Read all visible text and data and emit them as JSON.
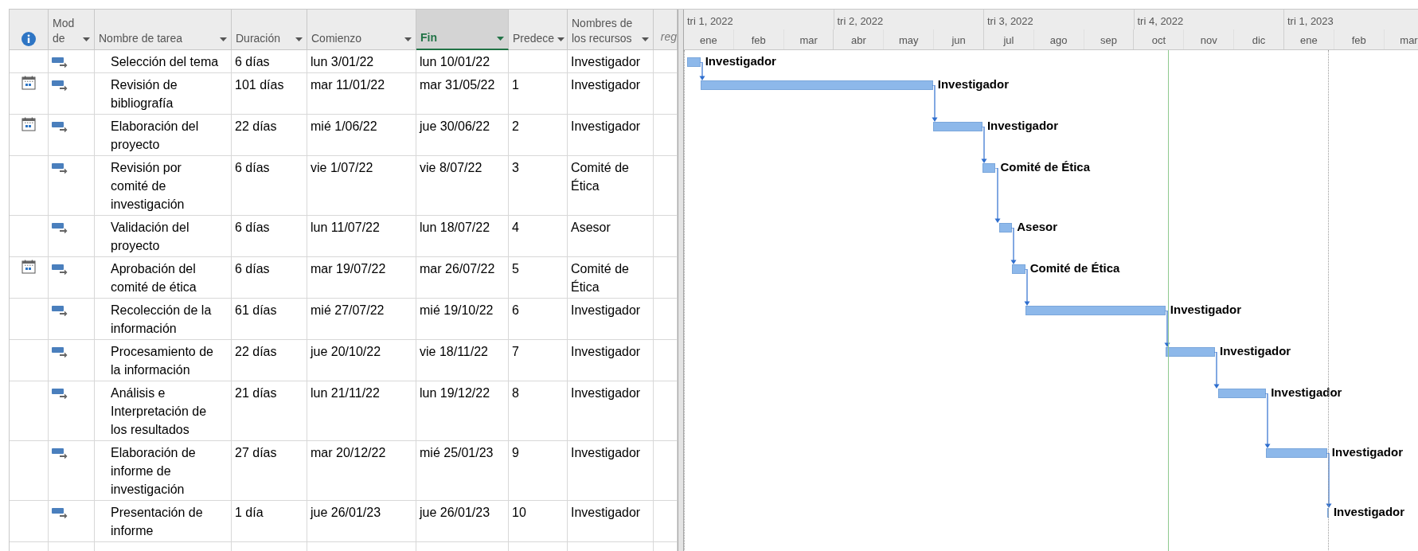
{
  "columns": [
    {
      "kind": "info",
      "selected": false
    },
    {
      "kind": "text",
      "label": "Mod de",
      "selected": false
    },
    {
      "kind": "text",
      "label": "Nombre de tarea",
      "selected": false
    },
    {
      "kind": "text",
      "label": "Duración",
      "selected": false
    },
    {
      "kind": "text",
      "label": "Comienzo",
      "selected": false
    },
    {
      "kind": "text",
      "label": "Fin",
      "selected": true
    },
    {
      "kind": "text",
      "label": "Predece",
      "selected": false
    },
    {
      "kind": "text",
      "label": "Nombres de los recursos",
      "selected": false
    },
    {
      "kind": "add",
      "label": "reg",
      "selected": false
    }
  ],
  "timescale": {
    "quarters": [
      "tri 1, 2022",
      "tri 2, 2022",
      "tri 3, 2022",
      "tri 4, 2022",
      "tri 1, 2023"
    ],
    "months": [
      "ene",
      "feb",
      "mar",
      "abr",
      "may",
      "jun",
      "jul",
      "ago",
      "sep",
      "oct",
      "nov",
      "dic",
      "ene",
      "feb",
      "mar"
    ]
  },
  "tasks": [
    {
      "calendar": false,
      "name": "Selección del tema",
      "duration": "6 días",
      "start": "lun 3/01/22",
      "finish": "lun 10/01/22",
      "resources": "Investigador",
      "bar_label": "Investigador"
    },
    {
      "calendar": true,
      "name": "Revisión de bibliografía",
      "duration": "101 días",
      "start": "mar 11/01/22",
      "finish": "mar 31/05/22",
      "predecessors": "1",
      "resources": "Investigador",
      "bar_label": "Investigador"
    },
    {
      "calendar": true,
      "name": "Elaboración del proyecto",
      "duration": "22 días",
      "start": "mié 1/06/22",
      "finish": "jue 30/06/22",
      "predecessors": "2",
      "resources": "Investigador",
      "bar_label": "Investigador"
    },
    {
      "calendar": false,
      "name": "Revisión por comité de investigación",
      "duration": "6 días",
      "start": "vie 1/07/22",
      "finish": "vie 8/07/22",
      "predecessors": "3",
      "resources": "Comité de Ética",
      "bar_label": "Comité de Ética"
    },
    {
      "calendar": false,
      "name": "Validación del proyecto",
      "duration": "6 días",
      "start": "lun 11/07/22",
      "finish": "lun 18/07/22",
      "predecessors": "4",
      "resources": "Asesor",
      "bar_label": "Asesor"
    },
    {
      "calendar": true,
      "name": "Aprobación del comité de ética",
      "duration": "6 días",
      "start": "mar 19/07/22",
      "finish": "mar 26/07/22",
      "predecessors": "5",
      "resources": "Comité de Ética",
      "bar_label": "Comité de Ética"
    },
    {
      "calendar": false,
      "name": "Recolección de la información",
      "duration": "61 días",
      "start": "mié 27/07/22",
      "finish": "mié 19/10/22",
      "predecessors": "6",
      "resources": "Investigador",
      "bar_label": "Investigador"
    },
    {
      "calendar": false,
      "name": "Procesamiento de la información",
      "duration": "22 días",
      "start": "jue 20/10/22",
      "finish": "vie 18/11/22",
      "predecessors": "7",
      "resources": "Investigador",
      "bar_label": "Investigador"
    },
    {
      "calendar": false,
      "name": "Análisis e Interpretación de los resultados",
      "duration": "21 días",
      "start": "lun 21/11/22",
      "finish": "lun 19/12/22",
      "predecessors": "8",
      "resources": "Investigador",
      "bar_label": "Investigador"
    },
    {
      "calendar": false,
      "name": "Elaboración de informe de investigación",
      "duration": "27 días",
      "start": "mar 20/12/22",
      "finish": "mié 25/01/23",
      "predecessors": "9",
      "resources": "Investigador",
      "bar_label": "Investigador"
    },
    {
      "calendar": false,
      "name": "Presentación de informe",
      "duration": "1 día",
      "start": "jue 26/01/23",
      "finish": "jue 26/01/23",
      "predecessors": "10",
      "resources": "Investigador",
      "bar_label": "Investigador"
    }
  ]
}
